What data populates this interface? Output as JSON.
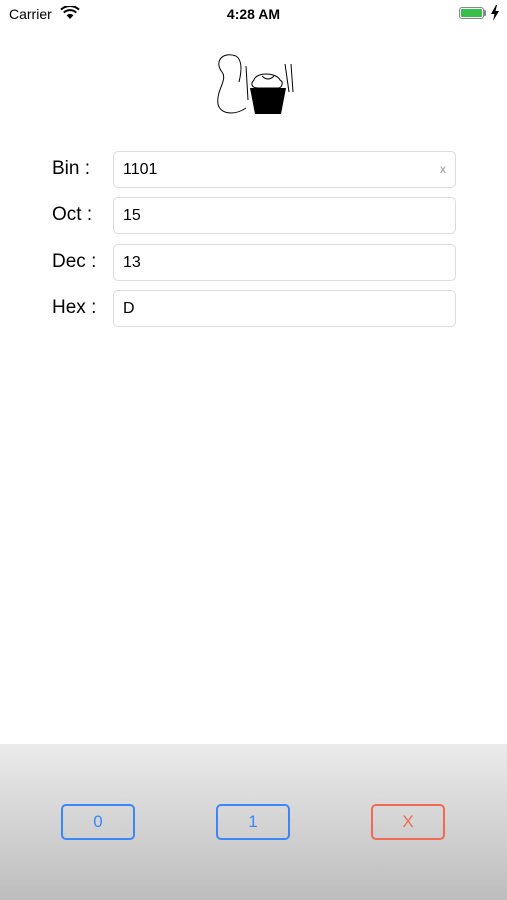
{
  "status_bar": {
    "carrier": "Carrier",
    "time": "4:28 AM",
    "battery_level": 1.0
  },
  "logo": {
    "icon": "app-logo-icon"
  },
  "converter": {
    "rows": [
      {
        "label": "Bin  :",
        "value": "1101",
        "clear": "x"
      },
      {
        "label": "Oct :",
        "value": "15"
      },
      {
        "label": "Dec :",
        "value": "13"
      },
      {
        "label": "Hex :",
        "value": "D"
      }
    ]
  },
  "keypad": {
    "zero_label": "0",
    "one_label": "1",
    "clear_label": "X"
  },
  "colors": {
    "key_blue": "#3d86f5",
    "key_red": "#ef6a55",
    "battery_green": "#36c04a"
  }
}
